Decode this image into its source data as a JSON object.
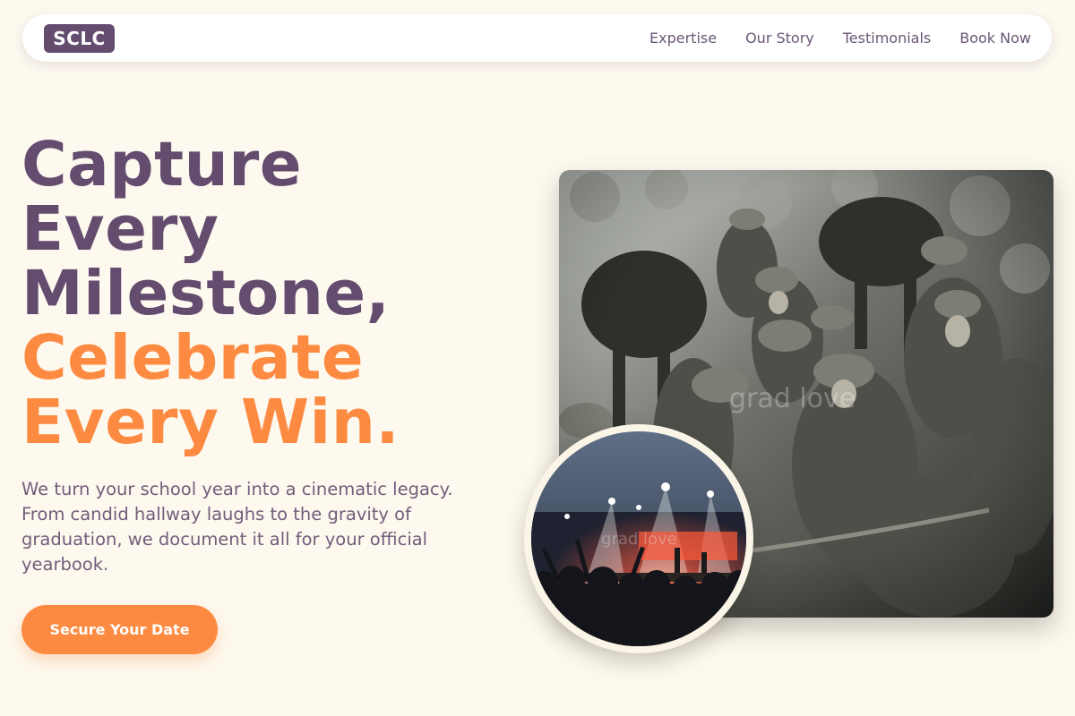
{
  "nav": {
    "logo": "SCLC",
    "links": [
      "Expertise",
      "Our Story",
      "Testimonials",
      "Book Now"
    ]
  },
  "hero": {
    "headline_lines": [
      "Capture",
      "Every",
      "Milestone,"
    ],
    "headline_accent_lines": [
      "Celebrate",
      "Every Win."
    ],
    "subtitle": "We turn your school year into a cinematic legacy. From candid hallway laughs to the gravity of graduation, we document it all for your official yearbook.",
    "cta_label": "Secure Your Date"
  },
  "images": {
    "main_watermark": "grad love",
    "circle_watermark": "grad love"
  },
  "colors": {
    "background": "#fdf9ef",
    "brand_purple": "#644c6f",
    "accent_orange": "#fd8a41"
  }
}
